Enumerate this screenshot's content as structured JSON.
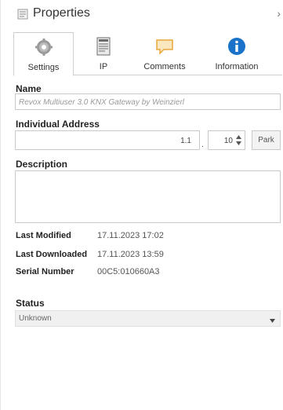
{
  "header": {
    "title": "Properties",
    "close_glyph": "›",
    "icon": "properties-icon"
  },
  "tabs": [
    {
      "label": "Settings",
      "icon": "gear-icon",
      "active": true
    },
    {
      "label": "IP",
      "icon": "document-icon",
      "active": false
    },
    {
      "label": "Comments",
      "icon": "comment-icon",
      "active": false
    },
    {
      "label": "Information",
      "icon": "info-icon",
      "active": false
    }
  ],
  "form": {
    "name_label": "Name",
    "name_placeholder": "Revox Multiuser 3.0 KNX Gateway by Weinzierl",
    "address_label": "Individual Address",
    "address_main": "1.1",
    "address_separator": ".",
    "address_sub": "10",
    "park_label": "Park",
    "description_label": "Description",
    "description_value": ""
  },
  "info": [
    {
      "key": "Last Modified",
      "value": "17.11.2023 17:02"
    },
    {
      "key": "Last Downloaded",
      "value": "17.11.2023 13:59"
    },
    {
      "key": "Serial Number",
      "value": "00C5:010660A3"
    }
  ],
  "status": {
    "label": "Status",
    "value": "Unknown"
  },
  "colors": {
    "info_icon": "#1a73c9",
    "comment_icon": "#e8a53a",
    "gear_icon": "#8a8a8a"
  }
}
